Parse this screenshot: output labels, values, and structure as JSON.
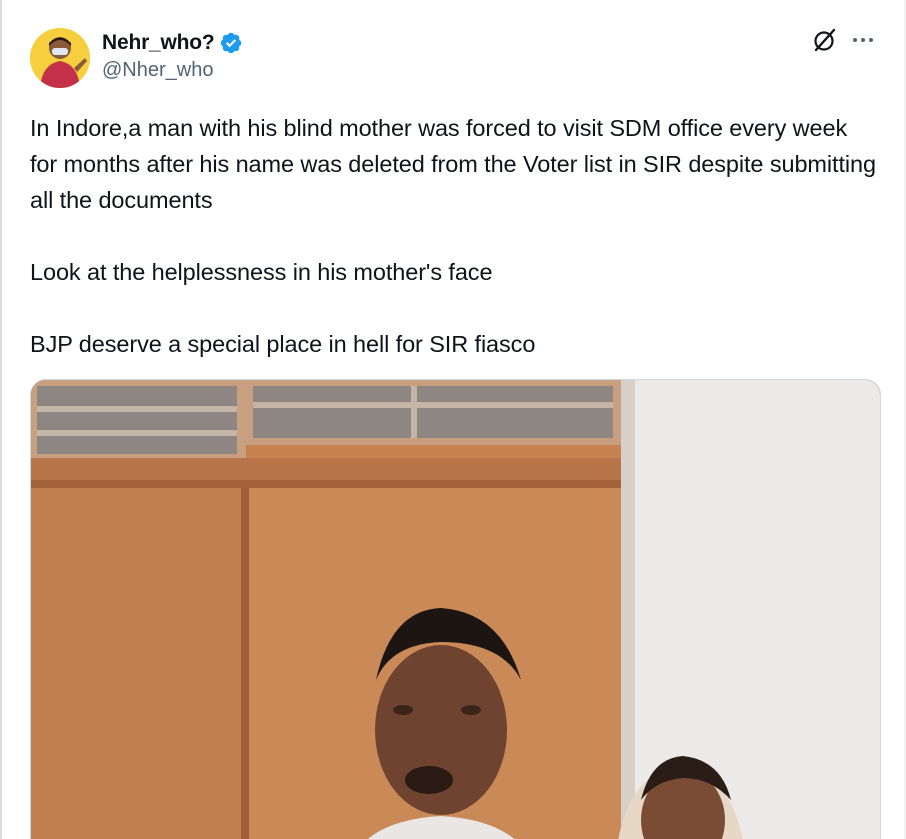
{
  "author": {
    "display_name": "Nehr_who?",
    "handle": "@Nher_who",
    "verified": true,
    "avatar_icon": "avatar-photo"
  },
  "actions": {
    "grok_icon": "grok-icon",
    "more_icon": "more-icon"
  },
  "tweet": {
    "paragraphs": [
      "In Indore,a man with his blind mother was forced to visit SDM office every week for months after his name was deleted from the Voter list in SIR despite submitting all the documents",
      "Look at the helplessness in his mother's face",
      "BJP deserve a special place in hell for SIR fiasco"
    ]
  },
  "media": {
    "type": "video-thumbnail"
  },
  "colors": {
    "text_primary": "#0f1419",
    "text_secondary": "#536471",
    "verified_blue": "#1d9bf0",
    "border": "#cfd9de"
  }
}
